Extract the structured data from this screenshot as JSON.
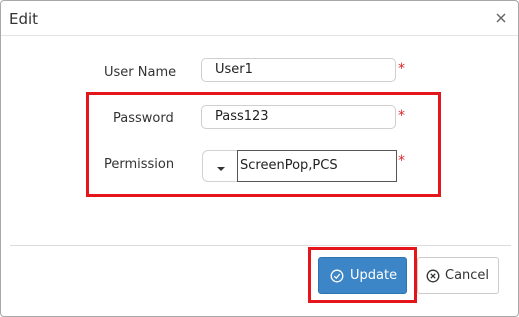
{
  "dialog": {
    "title": "Edit",
    "close_icon": "close-icon"
  },
  "form": {
    "user_name": {
      "label": "User Name",
      "value": "User1",
      "required_marker": "*"
    },
    "password": {
      "label": "Password",
      "value": "Pass123",
      "required_marker": "*"
    },
    "permission": {
      "label": "Permission",
      "value": "ScreenPop,PCS",
      "required_marker": "*",
      "toggle_icon": "caret-down-icon"
    }
  },
  "footer": {
    "update_label": "Update",
    "update_icon": "check-circle-icon",
    "cancel_label": "Cancel",
    "cancel_icon": "x-circle-icon"
  },
  "colors": {
    "primary_button": "#3c86c8",
    "required_marker": "#e0262a",
    "highlight_box": "#e4161c"
  }
}
